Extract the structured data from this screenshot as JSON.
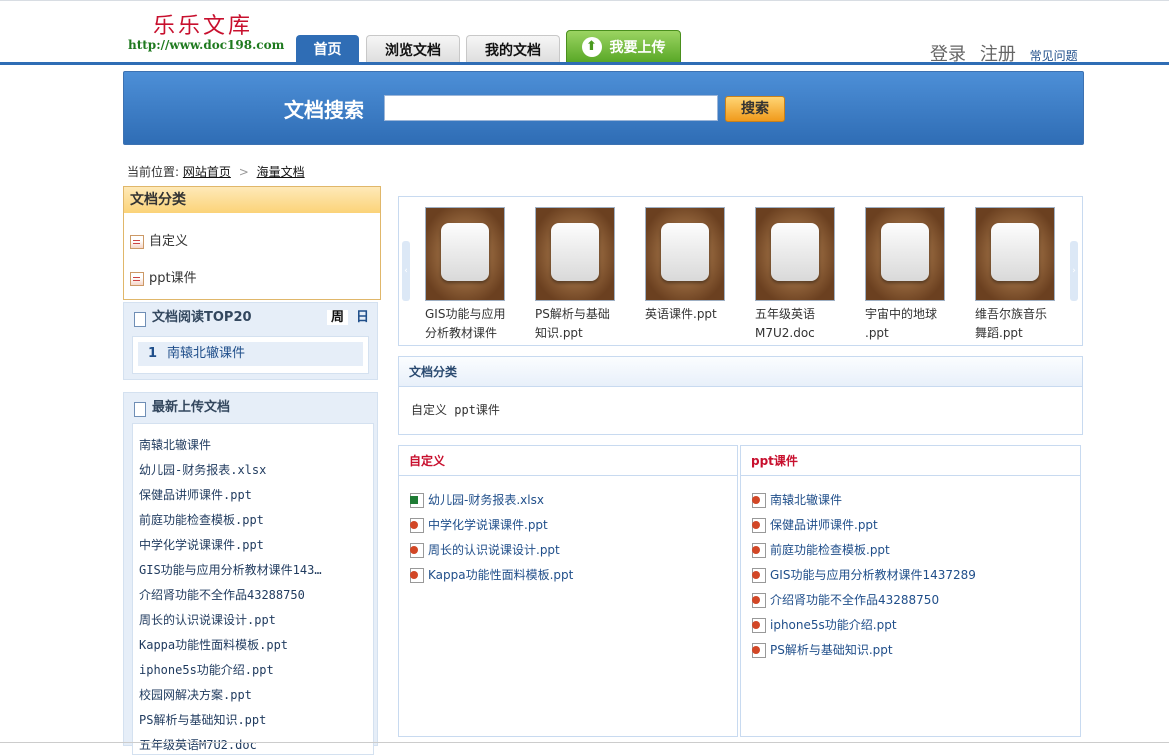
{
  "header": {
    "logo_title": "乐乐文库",
    "logo_url": "http://www.doc198.com",
    "nav_tabs": [
      "首页",
      "浏览文档",
      "我的文档"
    ],
    "upload_label": "我要上传",
    "login": "登录",
    "register": "注册",
    "faq": "常见问题"
  },
  "search": {
    "label": "文档搜索",
    "placeholder": "",
    "button": "搜索"
  },
  "breadcrumb": {
    "prefix": "当前位置:",
    "home": "网站首页",
    "sep": ">",
    "current": "海量文档"
  },
  "sidebar": {
    "category_title": "文档分类",
    "categories": [
      "自定义",
      "ppt课件"
    ],
    "top20_title": "文档阅读TOP20",
    "week": "周",
    "day": "日",
    "top20": [
      {
        "rank": "1",
        "title": "南辕北辙课件"
      }
    ],
    "latest_title": "最新上传文档",
    "latest": [
      "南辕北辙课件",
      "幼儿园-财务报表.xlsx",
      "保健品讲师课件.ppt",
      "前庭功能检查模板.ppt",
      "中学化学说课课件.ppt",
      "GIS功能与应用分析教材课件143…",
      "介绍肾功能不全作品43288750",
      "周长的认识说课设计.ppt",
      "Kappa功能性面料模板.ppt",
      "iphone5s功能介绍.ppt",
      "校园网解决方案.ppt",
      "PS解析与基础知识.ppt",
      "五年级英语M7U2.doc"
    ]
  },
  "carousel": {
    "items": [
      {
        "line1": "GIS功能与应用",
        "line2": "分析教材课件"
      },
      {
        "line1": "PS解析与基础",
        "line2": "知识.ppt"
      },
      {
        "line1": "英语课件.ppt",
        "line2": ""
      },
      {
        "line1": "五年级英语",
        "line2": "M7U2.doc"
      },
      {
        "line1": "宇宙中的地球",
        "line2": ".ppt"
      },
      {
        "line1": "维吾尔族音乐",
        "line2": "舞蹈.ppt"
      }
    ]
  },
  "main_category": {
    "title": "文档分类",
    "body": "自定义 ppt课件"
  },
  "lists": {
    "left": {
      "title": "自定义",
      "items": [
        {
          "type": "xls",
          "title": "幼儿园-财务报表.xlsx"
        },
        {
          "type": "ppt",
          "title": "中学化学说课课件.ppt"
        },
        {
          "type": "ppt",
          "title": "周长的认识说课设计.ppt"
        },
        {
          "type": "ppt",
          "title": "Kappa功能性面料模板.ppt"
        }
      ]
    },
    "right": {
      "title": "ppt课件",
      "items": [
        {
          "type": "ppt",
          "title": "南辕北辙课件"
        },
        {
          "type": "ppt",
          "title": "保健品讲师课件.ppt"
        },
        {
          "type": "ppt",
          "title": "前庭功能检查模板.ppt"
        },
        {
          "type": "ppt",
          "title": "GIS功能与应用分析教材课件1437289"
        },
        {
          "type": "ppt",
          "title": "介绍肾功能不全作品43288750"
        },
        {
          "type": "ppt",
          "title": "iphone5s功能介绍.ppt"
        },
        {
          "type": "ppt",
          "title": "PS解析与基础知识.ppt"
        }
      ]
    }
  },
  "colors": {
    "brand_blue": "#2f6db5",
    "logo_red": "#c8102e",
    "upload_green": "#55a523",
    "search_orange": "#f09a1c"
  }
}
